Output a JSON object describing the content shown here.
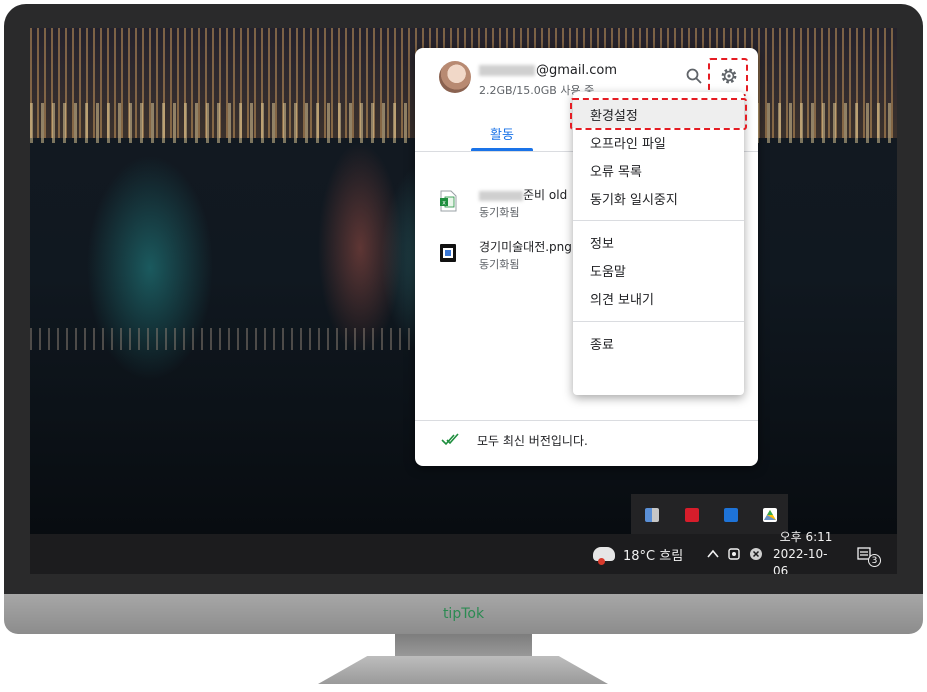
{
  "brand": "tipTok",
  "drive": {
    "account_email": "@gmail.com",
    "storage": "2.2GB/15.0GB 사용 중",
    "tab_activity": "활동",
    "files": [
      {
        "name_suffix": "준비 old",
        "status": "동기화됨",
        "icon": "excel-file-icon"
      },
      {
        "name": "경기미술대전.png",
        "status": "동기화됨",
        "icon": "image-file-icon"
      }
    ],
    "footer_status": "모두 최신 버전입니다."
  },
  "settings_menu": {
    "items": [
      "환경설정",
      "오프라인 파일",
      "오류 목록",
      "동기화 일시중지",
      "정보",
      "도움말",
      "의견 보내기",
      "종료"
    ]
  },
  "taskbar": {
    "weather": "18°C 흐림",
    "clock_time": "오후 6:11",
    "clock_date": "2022-10-06",
    "notification_count": "3"
  },
  "colors": {
    "accent": "#1a73e8",
    "highlight": "#e51c23",
    "brand": "#2c8a52"
  }
}
